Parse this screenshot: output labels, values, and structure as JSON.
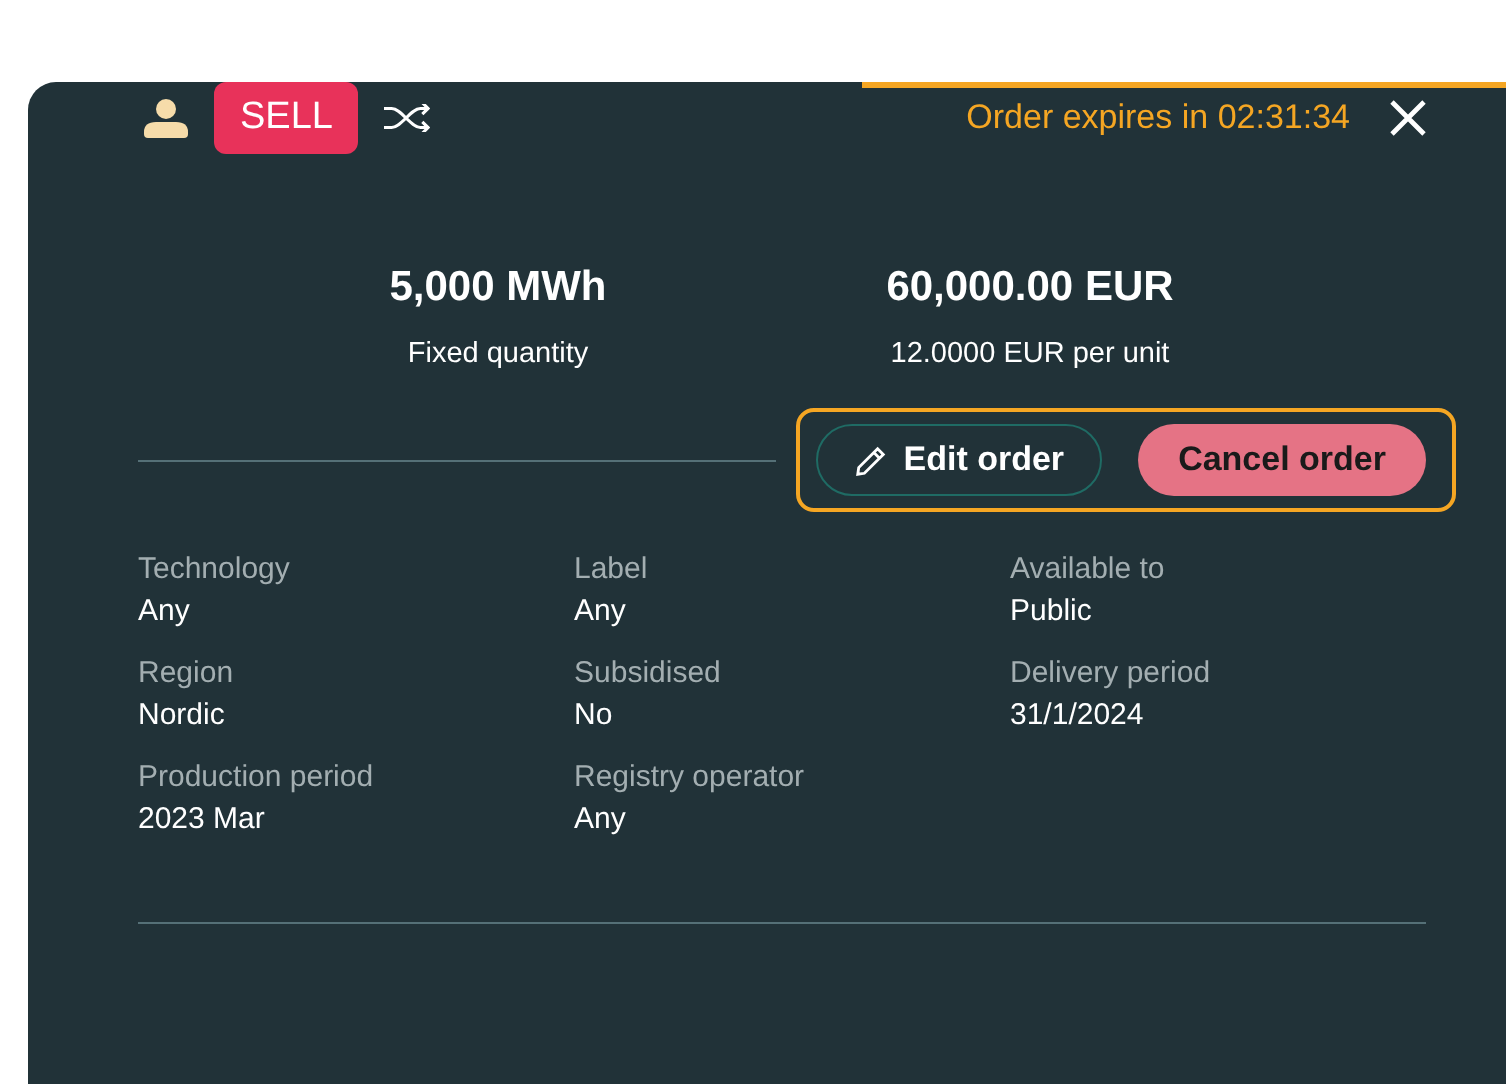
{
  "expiry_progress": {
    "level": 0.46
  },
  "header": {
    "side": "SELL",
    "expiry": "Order expires in 02:31:34"
  },
  "summary": [
    {
      "value": "5,000 MWh",
      "caption": "Fixed quantity"
    },
    {
      "value": "60,000.00 EUR",
      "caption": "12.0000 EUR per unit"
    }
  ],
  "actions": [
    {
      "kind": "edit",
      "label": "Edit order"
    },
    {
      "kind": "cancel",
      "label": "Cancel order"
    }
  ],
  "details": [
    {
      "label": "Technology",
      "value": "Any"
    },
    {
      "label": "Label",
      "value": "Any"
    },
    {
      "label": "Available to",
      "value": "Public"
    },
    {
      "label": "Region",
      "value": "Nordic"
    },
    {
      "label": "Subsidised",
      "value": "No"
    },
    {
      "label": "Delivery period",
      "value": "31/1/2024"
    },
    {
      "label": "Production period",
      "value": "2023 Mar"
    },
    {
      "label": "Registry operator",
      "value": "Any"
    }
  ]
}
